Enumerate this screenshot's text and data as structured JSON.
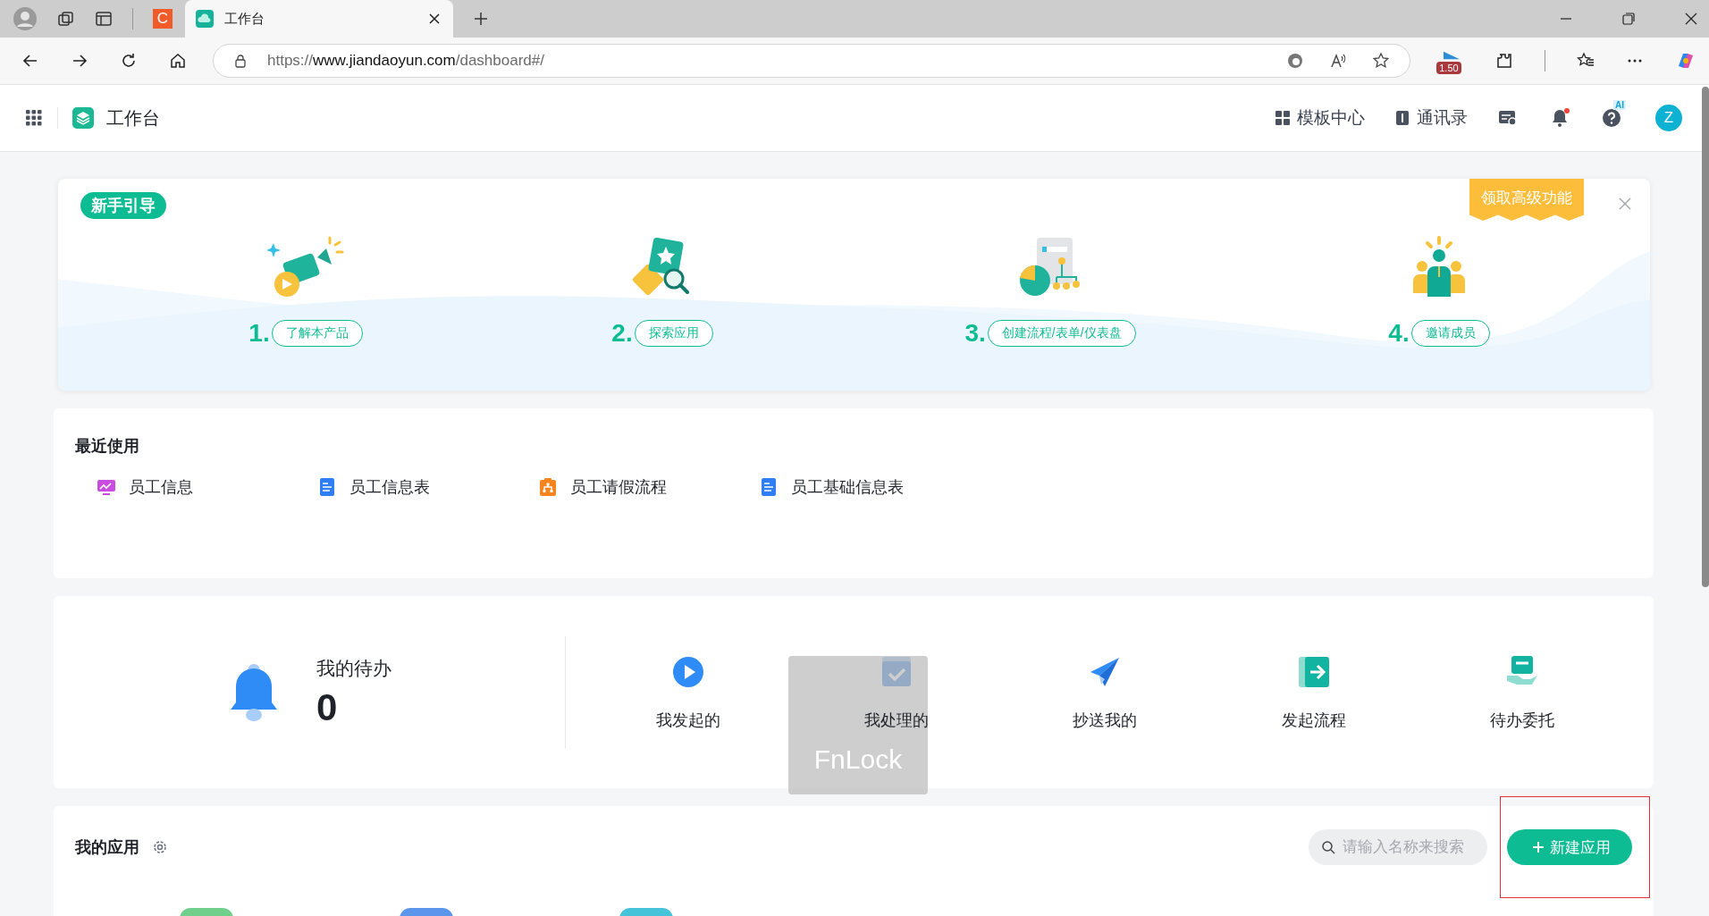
{
  "browser": {
    "tabs": [
      {
        "kind": "pinned",
        "label": "C",
        "selected": false
      },
      {
        "kind": "page",
        "label": "工作台",
        "selected": true
      }
    ],
    "url": {
      "scheme": "https://",
      "host": "www.jiandaoyun.com",
      "path": "/dashboard#/"
    },
    "extension_badge": "1.50"
  },
  "header": {
    "title": "工作台",
    "nav": [
      {
        "kind": "grid",
        "label": "模板中心"
      },
      {
        "kind": "book",
        "label": "通讯录"
      }
    ],
    "notification_dot": true,
    "ai_badge": "AI",
    "avatar": "Z"
  },
  "guide": {
    "badge": "新手引导",
    "promo": "领取高级功能",
    "steps": [
      {
        "kind": "video",
        "number": "1.",
        "label": "了解本产品"
      },
      {
        "kind": "explore",
        "number": "2.",
        "label": "探索应用"
      },
      {
        "kind": "chart",
        "number": "3.",
        "label": "创建流程/表单/仪表盘"
      },
      {
        "kind": "team",
        "number": "4.",
        "label": "邀请成员"
      }
    ]
  },
  "recent": {
    "title": "最近使用",
    "items": [
      {
        "kind": "dashboard",
        "label": "员工信息",
        "color": "#c94ee0"
      },
      {
        "kind": "form",
        "label": "员工信息表",
        "color": "#2f7ef5"
      },
      {
        "kind": "flow",
        "label": "员工请假流程",
        "color": "#f6851f"
      },
      {
        "kind": "form",
        "label": "员工基础信息表",
        "color": "#2f7ef5"
      }
    ]
  },
  "todo": {
    "title": "我的待办",
    "count": "0",
    "actions": [
      {
        "kind": "play",
        "label": "我发起的"
      },
      {
        "kind": "check",
        "label": "我处理的"
      },
      {
        "kind": "send",
        "label": "抄送我的"
      },
      {
        "kind": "start",
        "label": "发起流程"
      },
      {
        "kind": "delegate",
        "label": "待办委托"
      }
    ]
  },
  "apps": {
    "title": "我的应用",
    "search": {
      "placeholder": "请输入名称来搜索"
    },
    "new_button": "新建应用",
    "items": [
      {
        "color": "#6fcf8b"
      },
      {
        "color": "#5b95ec"
      },
      {
        "color": "#45c4d9"
      }
    ]
  },
  "overlay": {
    "label": "FnLock"
  }
}
